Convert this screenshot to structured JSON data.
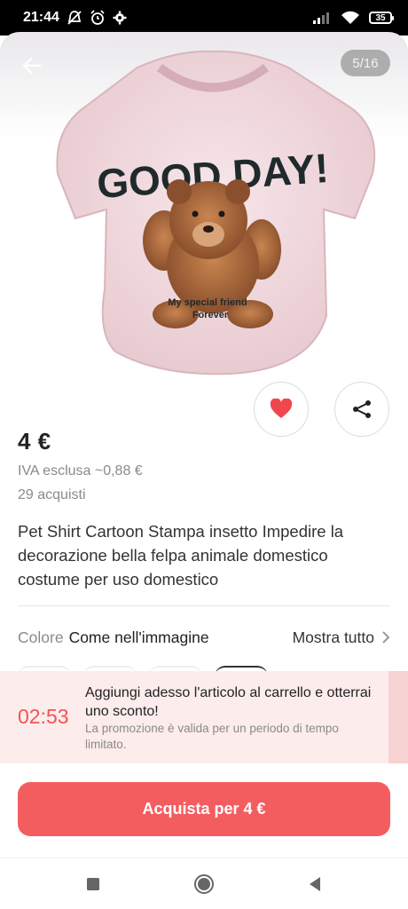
{
  "status_bar": {
    "time": "21:44",
    "battery": "35"
  },
  "gallery": {
    "counter": "5/16",
    "shirt_headline": "GOOD DAY!",
    "shirt_caption_1": "My special friend",
    "shirt_caption_2": "Forever"
  },
  "product": {
    "price": "4 €",
    "vat": "IVA esclusa ~0,88 €",
    "purchases": "29 acquisti",
    "title": "Pet Shirt Cartoon Stampa insetto Impedire la decorazione bella felpa animale domestico costume per uso domestico"
  },
  "color_selector": {
    "label": "Colore",
    "value": "Come nell'immagine",
    "show_all": "Mostra tutto"
  },
  "promo": {
    "timer": "02:53",
    "title": "Aggiungi adesso l'articolo al carrello e otterrai uno sconto!",
    "subtitle": "La promozione è valida per un periodo di tempo limitato."
  },
  "buy_button": {
    "label": "Acquista per 4 €"
  },
  "colors": {
    "accent": "#f45d60",
    "heart": "#f0474f",
    "promo_bg": "#fdecec",
    "timer": "#f05454"
  },
  "icons": {
    "back": "back-arrow-icon",
    "favorite": "heart-icon",
    "share": "share-icon",
    "chevron": "chevron-right-icon",
    "nav": [
      "recents-square-icon",
      "home-circle-icon",
      "back-triangle-icon"
    ]
  }
}
